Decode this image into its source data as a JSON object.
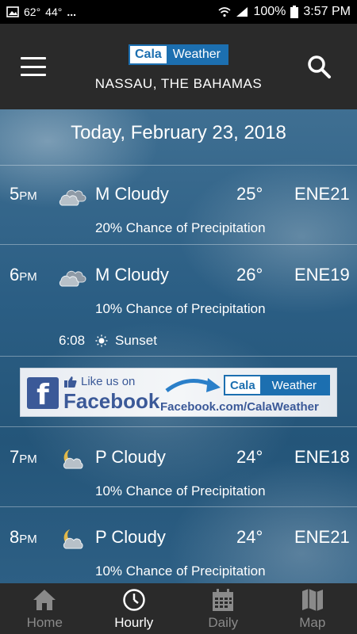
{
  "status_bar": {
    "temp_high": "62°",
    "temp_low": "44°",
    "more": "...",
    "battery_pct": "100%",
    "time": "3:57 PM"
  },
  "header": {
    "logo_cala": "Cala",
    "logo_weather": "Weather",
    "location": "NASSAU, THE BAHAMAS"
  },
  "date_title": "Today, February 23, 2018",
  "hours": [
    {
      "hour": "5",
      "ampm": "PM",
      "icon": "cloudy-icon",
      "condition": "M Cloudy",
      "temp": "25°",
      "wind": "ENE21",
      "precip": "20% Chance of Precipitation"
    },
    {
      "hour": "6",
      "ampm": "PM",
      "icon": "cloudy-icon",
      "condition": "M Cloudy",
      "temp": "26°",
      "wind": "ENE19",
      "precip": "10% Chance of Precipitation"
    },
    {
      "hour": "7",
      "ampm": "PM",
      "icon": "moon-cloud-icon",
      "condition": "P Cloudy",
      "temp": "24°",
      "wind": "ENE18",
      "precip": "10% Chance of Precipitation"
    },
    {
      "hour": "8",
      "ampm": "PM",
      "icon": "moon-cloud-icon",
      "condition": "P Cloudy",
      "temp": "24°",
      "wind": "ENE21",
      "precip": "10% Chance of Precipitation"
    }
  ],
  "sunset": {
    "time": "6:08",
    "label": "Sunset"
  },
  "facebook_banner": {
    "like_text": "Like us on",
    "facebook_text": "Facebook",
    "cala": "Cala",
    "weather": "Weather",
    "url": "Facebook.com/CalaWeather"
  },
  "nav": {
    "home": "Home",
    "hourly": "Hourly",
    "daily": "Daily",
    "map": "Map",
    "active": "hourly"
  },
  "colors": {
    "header_bg": "#2a2a2a",
    "brand_blue": "#1c6fb0",
    "facebook_blue": "#3b5998"
  }
}
